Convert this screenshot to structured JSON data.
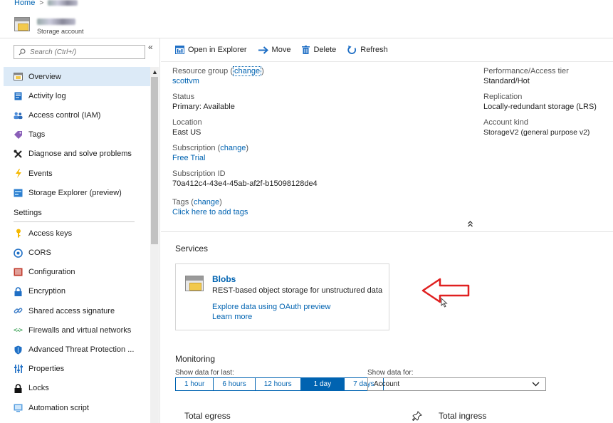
{
  "breadcrumb": {
    "home": "Home",
    "separator": ">"
  },
  "header": {
    "subtitle": "Storage account"
  },
  "sidebar": {
    "search_placeholder": "Search (Ctrl+/)",
    "collapse_glyph": "«",
    "items": [
      {
        "label": "Overview",
        "icon": "overview-icon",
        "active": true
      },
      {
        "label": "Activity log",
        "icon": "activity-log-icon"
      },
      {
        "label": "Access control (IAM)",
        "icon": "people-icon"
      },
      {
        "label": "Tags",
        "icon": "tag-icon"
      },
      {
        "label": "Diagnose and solve problems",
        "icon": "wrench-icon"
      },
      {
        "label": "Events",
        "icon": "lightning-icon"
      },
      {
        "label": "Storage Explorer (preview)",
        "icon": "storage-explorer-icon"
      }
    ],
    "settings_heading": "Settings",
    "settings_items": [
      {
        "label": "Access keys",
        "icon": "key-icon"
      },
      {
        "label": "CORS",
        "icon": "cors-icon"
      },
      {
        "label": "Configuration",
        "icon": "configuration-icon"
      },
      {
        "label": "Encryption",
        "icon": "lock-icon"
      },
      {
        "label": "Shared access signature",
        "icon": "link-icon"
      },
      {
        "label": "Firewalls and virtual networks",
        "icon": "network-icon"
      },
      {
        "label": "Advanced Threat Protection ...",
        "icon": "shield-icon"
      },
      {
        "label": "Properties",
        "icon": "properties-icon"
      },
      {
        "label": "Locks",
        "icon": "padlock-icon"
      },
      {
        "label": "Automation script",
        "icon": "script-icon"
      }
    ]
  },
  "toolbar": {
    "open_in_explorer": "Open in Explorer",
    "move": "Move",
    "delete": "Delete",
    "refresh": "Refresh"
  },
  "essentials": {
    "resource_group_label": "Resource group",
    "change": "change",
    "resource_group_value": "scottvm",
    "status_label": "Status",
    "status_value": "Primary: Available",
    "location_label": "Location",
    "location_value": "East US",
    "subscription_label": "Subscription",
    "subscription_value": "Free Trial",
    "subscription_id_label": "Subscription ID",
    "subscription_id_value": "70a412c4-43e4-45ab-af2f-b15098128de4",
    "tags_label": "Tags",
    "tags_value": "Click here to add tags",
    "performance_label": "Performance/Access tier",
    "performance_value": "Standard/Hot",
    "replication_label": "Replication",
    "replication_value": "Locally-redundant storage (LRS)",
    "account_kind_label": "Account kind",
    "account_kind_value": "StorageV2 (general purpose v2)",
    "collapse_glyph": "˄˄"
  },
  "services": {
    "title": "Services",
    "blobs": {
      "name": "Blobs",
      "description": "REST-based object storage for unstructured data",
      "link1": "Explore data using OAuth preview",
      "link2": "Learn more"
    }
  },
  "monitoring": {
    "title": "Monitoring",
    "show_last_label": "Show data for last:",
    "time_options": [
      "1 hour",
      "6 hours",
      "12 hours",
      "1 day",
      "7 days"
    ],
    "selected_option": "1 day",
    "show_for_label": "Show data for:",
    "show_for_value": "Account",
    "total_egress": "Total egress",
    "total_ingress": "Total ingress"
  },
  "colors": {
    "accent": "#0063b1",
    "active_bg": "#dceaf7",
    "arrow": "#e02020"
  }
}
